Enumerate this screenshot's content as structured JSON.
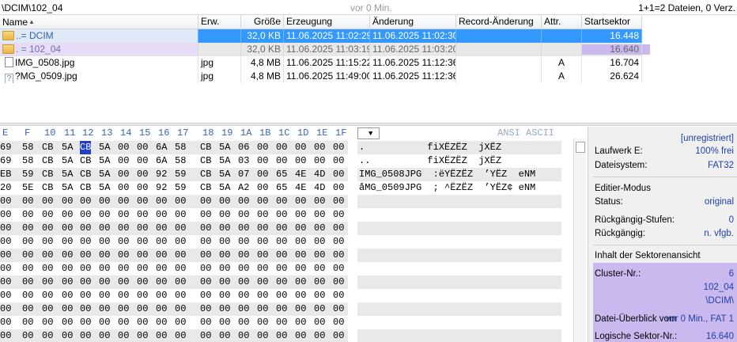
{
  "pathbar": {
    "path": "\\DCIM\\102_04",
    "age": "vor 0 Min.",
    "count": "1+1=2 Dateien, 0 Verz."
  },
  "filelist": {
    "columns": [
      "Name",
      "Erw.",
      "Größe",
      "Erzeugung",
      "Änderung",
      "Record-Änderung",
      "Attr.",
      "Startsektor"
    ],
    "rows": [
      {
        "name": "..= DCIM",
        "ext": "",
        "size": "32,0 KB",
        "created": "11.06.2025 11:02:29",
        "modified": "11.06.2025 11:02:30",
        "record": "",
        "attr": "",
        "start": "16.448",
        "icon": "folder-icon"
      },
      {
        "name": ". = 102_04",
        "ext": "",
        "size": "32,0 KB",
        "created": "11.06.2025 11:03:19",
        "modified": "11.06.2025 11:03:20",
        "record": "",
        "attr": "",
        "start": "16.640",
        "icon": "folder-icon"
      },
      {
        "name": "IMG_0508.jpg",
        "ext": "jpg",
        "size": "4,8 MB",
        "created": "11.06.2025 11:15:22",
        "modified": "11.06.2025 11:12:36",
        "record": "",
        "attr": "A",
        "start": "16.704",
        "icon": "file-icon"
      },
      {
        "name": "?MG_0509.jpg",
        "ext": "jpg",
        "size": "4,8 MB",
        "created": "11.06.2025 11:49:00",
        "modified": "11.06.2025 11:12:36",
        "record": "",
        "attr": "A",
        "start": "26.624",
        "icon": "deleted-file-icon"
      }
    ]
  },
  "hex": {
    "columns": [
      "E",
      "F",
      "10",
      "11",
      "12",
      "13",
      "14",
      "15",
      "16",
      "17",
      "18",
      "19",
      "1A",
      "1B",
      "1C",
      "1D",
      "1E",
      "1F"
    ],
    "text_header": "ANSI ASCII",
    "dropdown_glyph": "▼",
    "rows": [
      {
        "bytes": [
          "69",
          "58",
          "CB",
          "5A",
          "CB",
          "5A",
          "00",
          "00",
          "6A",
          "58",
          "CB",
          "5A",
          "06",
          "00",
          "00",
          "00",
          "00",
          "00"
        ],
        "text": ".           fiXËZËZ  jXËZ"
      },
      {
        "bytes": [
          "69",
          "58",
          "CB",
          "5A",
          "CB",
          "5A",
          "00",
          "00",
          "6A",
          "58",
          "CB",
          "5A",
          "03",
          "00",
          "00",
          "00",
          "00",
          "00"
        ],
        "text": "..          fiXËZËZ  jXËZ"
      },
      {
        "bytes": [
          "EB",
          "59",
          "CB",
          "5A",
          "CB",
          "5A",
          "00",
          "00",
          "92",
          "59",
          "CB",
          "5A",
          "07",
          "00",
          "65",
          "4E",
          "4D",
          "00"
        ],
        "text": "IMG_0508JPG  :ëYËZËZ  ’YËZ  eNM"
      },
      {
        "bytes": [
          "20",
          "5E",
          "CB",
          "5A",
          "CB",
          "5A",
          "00",
          "00",
          "92",
          "59",
          "CB",
          "5A",
          "A2",
          "00",
          "65",
          "4E",
          "4D",
          "00"
        ],
        "text": "åMG_0509JPG  ; ^ËZËZ  ’YËZ¢ eNM"
      },
      {
        "bytes": [
          "00",
          "00",
          "00",
          "00",
          "00",
          "00",
          "00",
          "00",
          "00",
          "00",
          "00",
          "00",
          "00",
          "00",
          "00",
          "00",
          "00",
          "00"
        ],
        "text": ""
      },
      {
        "bytes": [
          "00",
          "00",
          "00",
          "00",
          "00",
          "00",
          "00",
          "00",
          "00",
          "00",
          "00",
          "00",
          "00",
          "00",
          "00",
          "00",
          "00",
          "00"
        ],
        "text": ""
      },
      {
        "bytes": [
          "00",
          "00",
          "00",
          "00",
          "00",
          "00",
          "00",
          "00",
          "00",
          "00",
          "00",
          "00",
          "00",
          "00",
          "00",
          "00",
          "00",
          "00"
        ],
        "text": ""
      },
      {
        "bytes": [
          "00",
          "00",
          "00",
          "00",
          "00",
          "00",
          "00",
          "00",
          "00",
          "00",
          "00",
          "00",
          "00",
          "00",
          "00",
          "00",
          "00",
          "00"
        ],
        "text": ""
      },
      {
        "bytes": [
          "00",
          "00",
          "00",
          "00",
          "00",
          "00",
          "00",
          "00",
          "00",
          "00",
          "00",
          "00",
          "00",
          "00",
          "00",
          "00",
          "00",
          "00"
        ],
        "text": ""
      },
      {
        "bytes": [
          "00",
          "00",
          "00",
          "00",
          "00",
          "00",
          "00",
          "00",
          "00",
          "00",
          "00",
          "00",
          "00",
          "00",
          "00",
          "00",
          "00",
          "00"
        ],
        "text": ""
      },
      {
        "bytes": [
          "00",
          "00",
          "00",
          "00",
          "00",
          "00",
          "00",
          "00",
          "00",
          "00",
          "00",
          "00",
          "00",
          "00",
          "00",
          "00",
          "00",
          "00"
        ],
        "text": ""
      },
      {
        "bytes": [
          "00",
          "00",
          "00",
          "00",
          "00",
          "00",
          "00",
          "00",
          "00",
          "00",
          "00",
          "00",
          "00",
          "00",
          "00",
          "00",
          "00",
          "00"
        ],
        "text": ""
      },
      {
        "bytes": [
          "00",
          "00",
          "00",
          "00",
          "00",
          "00",
          "00",
          "00",
          "00",
          "00",
          "00",
          "00",
          "00",
          "00",
          "00",
          "00",
          "00",
          "00"
        ],
        "text": ""
      },
      {
        "bytes": [
          "00",
          "00",
          "00",
          "00",
          "00",
          "00",
          "00",
          "00",
          "00",
          "00",
          "00",
          "00",
          "00",
          "00",
          "00",
          "00",
          "00",
          "00"
        ],
        "text": ""
      },
      {
        "bytes": [
          "00",
          "00",
          "00",
          "00",
          "00",
          "00",
          "00",
          "00",
          "00",
          "00",
          "00",
          "00",
          "00",
          "00",
          "00",
          "00",
          "00",
          "00"
        ],
        "text": ""
      }
    ]
  },
  "info": {
    "registration": "[unregistriert]",
    "drive_label": "Laufwerk E:",
    "drive_value": "100% frei",
    "fs_label": "Dateisystem:",
    "fs_value": "FAT32",
    "edit_mode": "Editier-Modus",
    "status_label": "Status:",
    "status_value": "original",
    "undo_levels_label": "Rückgängig-Stufen:",
    "undo_levels_value": "0",
    "undo_label": "Rückgängig:",
    "undo_value": "n. vfgb.",
    "sector_view": "Inhalt der Sektorenansicht",
    "cluster_label": "Cluster-Nr.:",
    "cluster_value": "6",
    "cluster_dir1": "102_04",
    "cluster_dir2": "\\DCIM\\",
    "overview_label": "Datei-Überblick vom",
    "overview_value": "vor 0 Min., FAT 1",
    "logical_label": "Logische Sektor-Nr.:",
    "logical_value": "16.640"
  },
  "colors": {
    "selection_blue": "#3399ff",
    "highlight_purple": "#c9b9ef",
    "hex_header_blue": "#3a64b8",
    "value_blue": "#1f3fa8",
    "cursor_blue": "#1f3fd0"
  }
}
